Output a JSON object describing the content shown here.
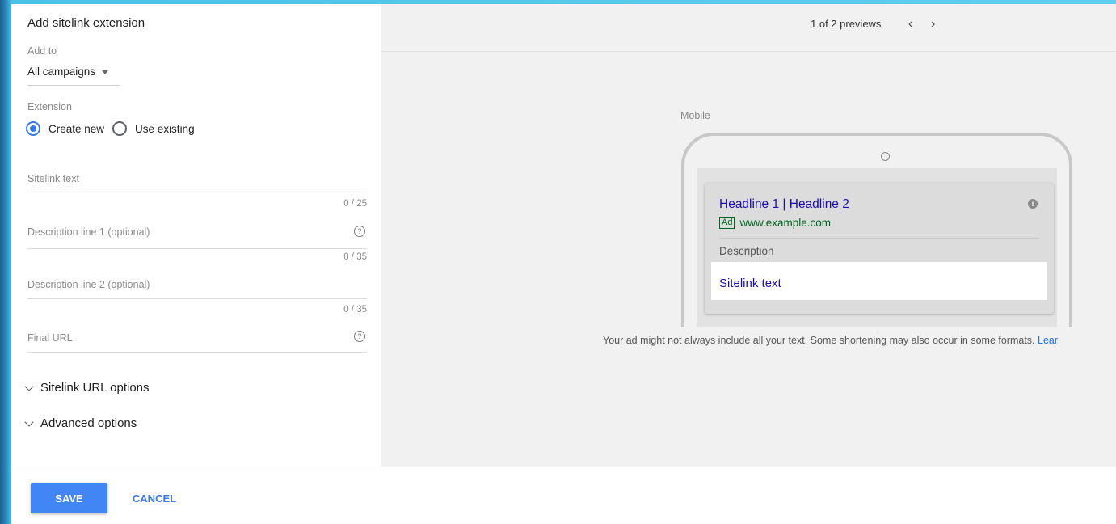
{
  "panel": {
    "title": "Add sitelink extension",
    "add_to_label": "Add to",
    "add_to_value": "All campaigns",
    "extension_label": "Extension",
    "extension_options": [
      "Create new",
      "Use existing"
    ],
    "extension_selected": "Create new"
  },
  "fields": {
    "sitelink_text": {
      "placeholder": "Sitelink text",
      "counter": "0 / 25"
    },
    "description1": {
      "placeholder": "Description line 1 (optional)",
      "counter": "0 / 35"
    },
    "description2": {
      "placeholder": "Description line 2 (optional)",
      "counter": "0 / 35"
    },
    "final_url": {
      "placeholder": "Final URL"
    }
  },
  "expanders": {
    "sitelink_url_options": "Sitelink URL options",
    "advanced_options": "Advanced options"
  },
  "preview": {
    "count": "1 of 2 previews",
    "prev_arrow": "‹",
    "next_arrow": "›",
    "device_label": "Mobile",
    "headline": "Headline 1 | Headline 2",
    "ad_badge": "Ad",
    "display_url": "www.example.com",
    "description": "Description",
    "sitelink_text": "Sitelink text",
    "disclaimer": "Your ad might not always include all your text. Some shortening may also occur in some formats.",
    "learn_more": "Lear"
  },
  "footer": {
    "save": "SAVE",
    "cancel": "CANCEL"
  },
  "colors": {
    "primary": "#4285f4",
    "link": "#1a0dab",
    "url_green": "#006621"
  }
}
